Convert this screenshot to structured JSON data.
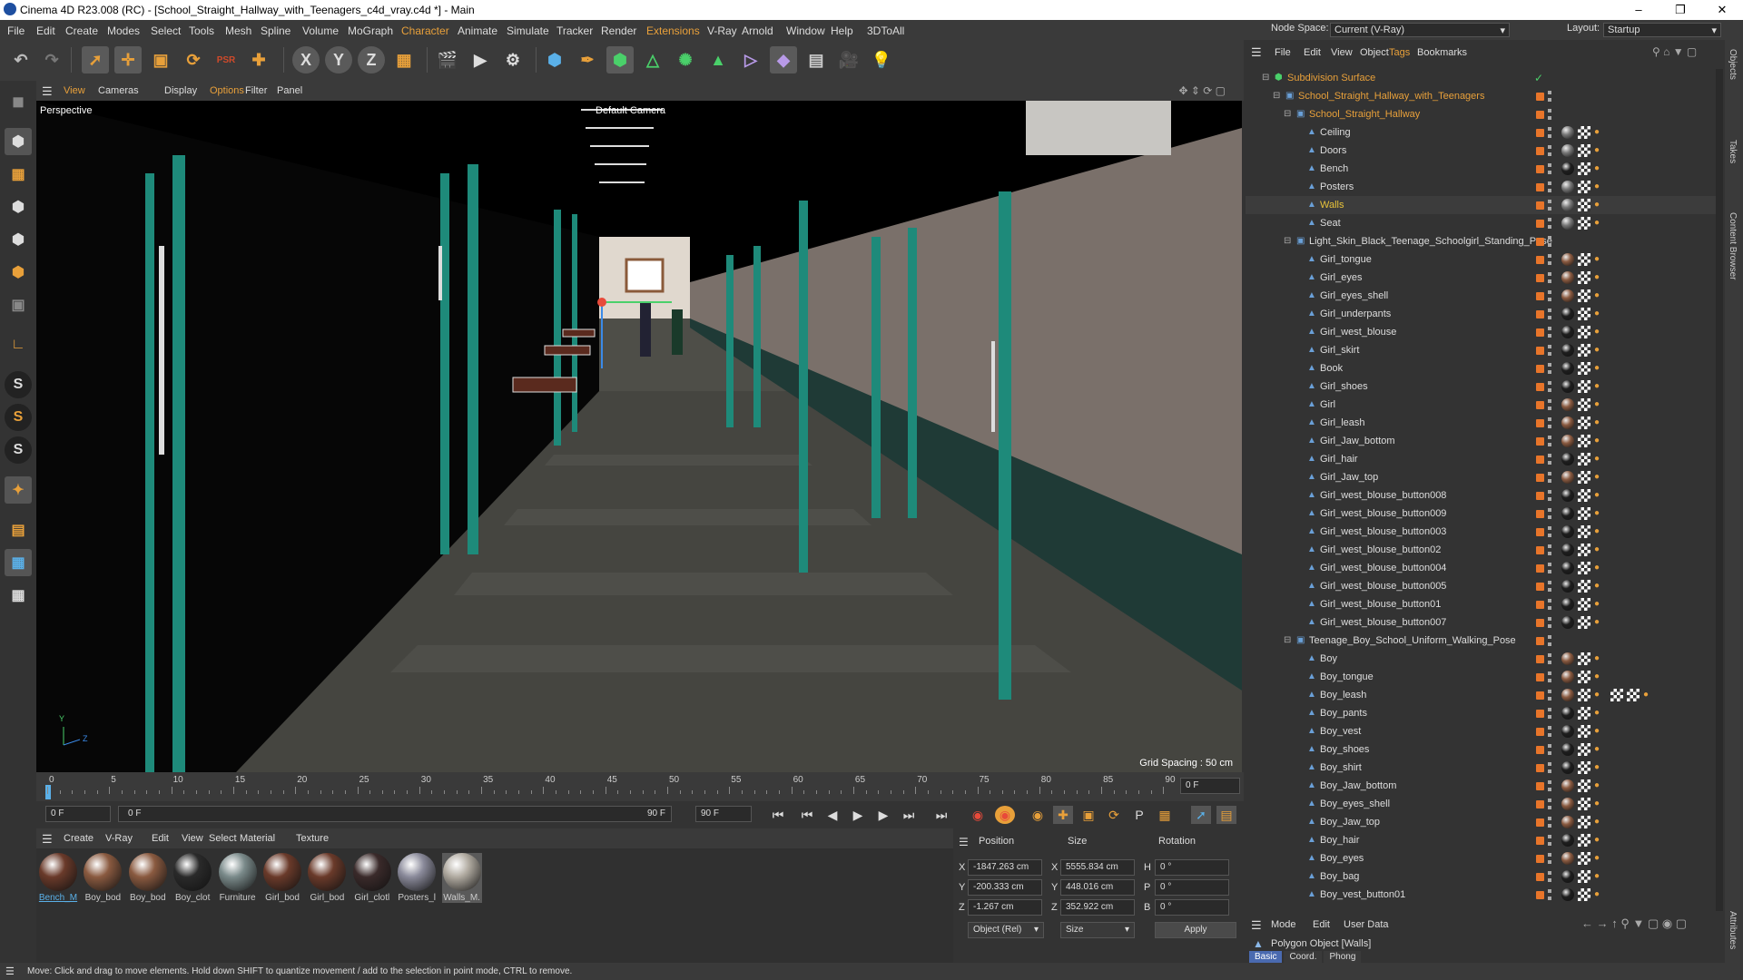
{
  "window": {
    "title": "Cinema 4D R23.008 (RC) - [School_Straight_Hallway_with_Teenagers_c4d_vray.c4d *] - Main"
  },
  "menu": [
    "File",
    "Edit",
    "Create",
    "Modes",
    "Select",
    "Tools",
    "Mesh",
    "Spline",
    "Volume",
    "MoGraph",
    "Character",
    "Animate",
    "Simulate",
    "Tracker",
    "Render",
    "Extensions",
    "V-Ray",
    "Arnold",
    "Window",
    "Help",
    "3DToAll"
  ],
  "nodespace": {
    "label": "Node Space:",
    "value": "Current (V-Ray)"
  },
  "layout": {
    "label": "Layout:",
    "value": "Startup"
  },
  "viewport": {
    "menu": [
      "View",
      "Cameras",
      "Display",
      "Options",
      "Filter",
      "Panel"
    ],
    "name": "Perspective",
    "camera": "Default Camera",
    "grid": "Grid Spacing : 50 cm"
  },
  "timeline": {
    "ticks": [
      "0",
      "5",
      "10",
      "15",
      "20",
      "25",
      "30",
      "35",
      "40",
      "45",
      "50",
      "55",
      "60",
      "65",
      "70",
      "75",
      "80",
      "85",
      "90"
    ],
    "current": "0 F",
    "start": "0 F",
    "range_start": "0 F",
    "range_end": "90 F",
    "end": "90 F"
  },
  "matmenu": [
    "Create",
    "V-Ray",
    "Edit",
    "View",
    "Select",
    "Material",
    "Texture"
  ],
  "materials": [
    {
      "name": "Bench_M",
      "color": "#6a3a2a"
    },
    {
      "name": "Boy_bod",
      "color": "#8a5a40"
    },
    {
      "name": "Boy_bod",
      "color": "#8a5a40"
    },
    {
      "name": "Boy_clot",
      "color": "#2a2a2a"
    },
    {
      "name": "Furniture",
      "color": "#7a8a8a"
    },
    {
      "name": "Girl_bod",
      "color": "#6a3a2a"
    },
    {
      "name": "Girl_bod",
      "color": "#6a3a2a"
    },
    {
      "name": "Girl_clotl",
      "color": "#3a2a2a"
    },
    {
      "name": "Posters_l",
      "color": "#8a8a9a"
    },
    {
      "name": "Walls_M.",
      "color": "#b0aaa0"
    }
  ],
  "coords": {
    "headers": [
      "Position",
      "Size",
      "Rotation"
    ],
    "x": "-1847.263 cm",
    "y": "-200.333 cm",
    "z": "-1.267 cm",
    "sx": "5555.834 cm",
    "sy": "448.016 cm",
    "sz": "352.922 cm",
    "h": "0 °",
    "p": "0 °",
    "b": "0 °",
    "mode": "Object (Rel)",
    "size_mode": "Size",
    "apply": "Apply"
  },
  "objmenu": [
    "File",
    "Edit",
    "View",
    "Object",
    "Tags",
    "Bookmarks"
  ],
  "objects": [
    {
      "name": "Subdivision Surface",
      "indent": 0,
      "color": "#e8a03a",
      "tag": "none"
    },
    {
      "name": "School_Straight_Hallway_with_Teenagers",
      "indent": 1,
      "color": "#e8a03a",
      "tag": "none"
    },
    {
      "name": "School_Straight_Hallway",
      "indent": 2,
      "color": "#e8a03a",
      "tag": "none"
    },
    {
      "name": "Ceiling",
      "indent": 3,
      "color": "#ddd",
      "tag": "grey"
    },
    {
      "name": "Doors",
      "indent": 3,
      "color": "#ddd",
      "tag": "grey"
    },
    {
      "name": "Bench",
      "indent": 3,
      "color": "#ddd",
      "tag": "dark"
    },
    {
      "name": "Posters",
      "indent": 3,
      "color": "#ddd",
      "tag": "grey"
    },
    {
      "name": "Walls",
      "indent": 3,
      "color": "#e8c33a",
      "tag": "grey"
    },
    {
      "name": "Seat",
      "indent": 3,
      "color": "#ddd",
      "tag": "grey"
    },
    {
      "name": "Light_Skin_Black_Teenage_Schoolgirl_Standing_Pose",
      "indent": 2,
      "color": "#ddd",
      "tag": "none"
    },
    {
      "name": "Girl_tongue",
      "indent": 3,
      "color": "#ddd",
      "tag": "skin"
    },
    {
      "name": "Girl_eyes",
      "indent": 3,
      "color": "#ddd",
      "tag": "skin"
    },
    {
      "name": "Girl_eyes_shell",
      "indent": 3,
      "color": "#ddd",
      "tag": "skin"
    },
    {
      "name": "Girl_underpants",
      "indent": 3,
      "color": "#ddd",
      "tag": "dark"
    },
    {
      "name": "Girl_west_blouse",
      "indent": 3,
      "color": "#ddd",
      "tag": "dark"
    },
    {
      "name": "Girl_skirt",
      "indent": 3,
      "color": "#ddd",
      "tag": "dark"
    },
    {
      "name": "Book",
      "indent": 3,
      "color": "#ddd",
      "tag": "dark"
    },
    {
      "name": "Girl_shoes",
      "indent": 3,
      "color": "#ddd",
      "tag": "dark"
    },
    {
      "name": "Girl",
      "indent": 3,
      "color": "#ddd",
      "tag": "skin"
    },
    {
      "name": "Girl_leash",
      "indent": 3,
      "color": "#ddd",
      "tag": "skin"
    },
    {
      "name": "Girl_Jaw_bottom",
      "indent": 3,
      "color": "#ddd",
      "tag": "skin"
    },
    {
      "name": "Girl_hair",
      "indent": 3,
      "color": "#ddd",
      "tag": "dark"
    },
    {
      "name": "Girl_Jaw_top",
      "indent": 3,
      "color": "#ddd",
      "tag": "skin"
    },
    {
      "name": "Girl_west_blouse_button008",
      "indent": 3,
      "color": "#ddd",
      "tag": "dark"
    },
    {
      "name": "Girl_west_blouse_button009",
      "indent": 3,
      "color": "#ddd",
      "tag": "dark"
    },
    {
      "name": "Girl_west_blouse_button003",
      "indent": 3,
      "color": "#ddd",
      "tag": "dark"
    },
    {
      "name": "Girl_west_blouse_button02",
      "indent": 3,
      "color": "#ddd",
      "tag": "dark"
    },
    {
      "name": "Girl_west_blouse_button004",
      "indent": 3,
      "color": "#ddd",
      "tag": "dark"
    },
    {
      "name": "Girl_west_blouse_button005",
      "indent": 3,
      "color": "#ddd",
      "tag": "dark"
    },
    {
      "name": "Girl_west_blouse_button01",
      "indent": 3,
      "color": "#ddd",
      "tag": "dark"
    },
    {
      "name": "Girl_west_blouse_button007",
      "indent": 3,
      "color": "#ddd",
      "tag": "dark"
    },
    {
      "name": "Teenage_Boy_School_Uniform_Walking_Pose",
      "indent": 2,
      "color": "#ddd",
      "tag": "none"
    },
    {
      "name": "Boy",
      "indent": 3,
      "color": "#ddd",
      "tag": "skin"
    },
    {
      "name": "Boy_tongue",
      "indent": 3,
      "color": "#ddd",
      "tag": "skin"
    },
    {
      "name": "Boy_leash",
      "indent": 3,
      "color": "#ddd",
      "tag": "skin"
    },
    {
      "name": "Boy_pants",
      "indent": 3,
      "color": "#ddd",
      "tag": "dark"
    },
    {
      "name": "Boy_vest",
      "indent": 3,
      "color": "#ddd",
      "tag": "dark"
    },
    {
      "name": "Boy_shoes",
      "indent": 3,
      "color": "#ddd",
      "tag": "dark"
    },
    {
      "name": "Boy_shirt",
      "indent": 3,
      "color": "#ddd",
      "tag": "dark"
    },
    {
      "name": "Boy_Jaw_bottom",
      "indent": 3,
      "color": "#ddd",
      "tag": "skin"
    },
    {
      "name": "Boy_eyes_shell",
      "indent": 3,
      "color": "#ddd",
      "tag": "skin"
    },
    {
      "name": "Boy_Jaw_top",
      "indent": 3,
      "color": "#ddd",
      "tag": "skin"
    },
    {
      "name": "Boy_hair",
      "indent": 3,
      "color": "#ddd",
      "tag": "dark"
    },
    {
      "name": "Boy_eyes",
      "indent": 3,
      "color": "#ddd",
      "tag": "skin"
    },
    {
      "name": "Boy_bag",
      "indent": 3,
      "color": "#ddd",
      "tag": "dark"
    },
    {
      "name": "Boy_vest_button01",
      "indent": 3,
      "color": "#ddd",
      "tag": "dark"
    }
  ],
  "attributes": {
    "menu": [
      "Mode",
      "Edit",
      "User Data"
    ],
    "title": "Polygon Object [Walls]",
    "tabs": [
      "Basic",
      "Coord.",
      "Phong"
    ]
  },
  "side_tabs": [
    "Objects",
    "Takes",
    "Content Browser",
    "Attributes"
  ],
  "status": "Move: Click and drag to move elements. Hold down SHIFT to quantize movement / add to the selection in point mode, CTRL to remove."
}
